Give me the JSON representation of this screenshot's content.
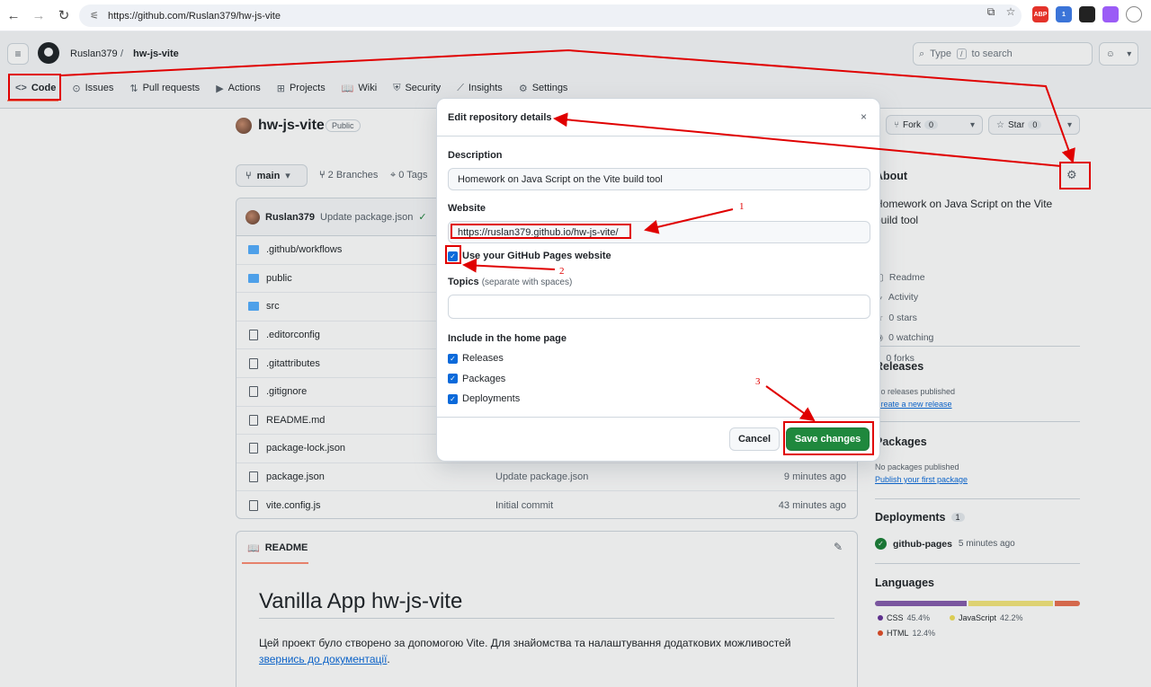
{
  "browser": {
    "url": "https://github.com/Ruslan379/hw-js-vite",
    "back_icon": "←",
    "forward_icon": "→",
    "reload_icon": "↻",
    "extensions": [
      {
        "label": "ABP",
        "color": "#e4332a"
      },
      {
        "label": "1",
        "color": "#3b74d8"
      },
      {
        "label": "",
        "color": "#222222"
      },
      {
        "label": "",
        "color": "#9b5cf6"
      },
      {
        "label": "",
        "color": "#888888"
      }
    ]
  },
  "header": {
    "owner": "Ruslan379",
    "separator": "/",
    "repo": "hw-js-vite",
    "search_placeholder": "Type",
    "search_key": "/",
    "search_suffix": "to search"
  },
  "tabs": [
    {
      "label": "Code",
      "icon": "<>"
    },
    {
      "label": "Issues",
      "icon": "⊙"
    },
    {
      "label": "Pull requests",
      "icon": "⇅"
    },
    {
      "label": "Actions",
      "icon": "▶"
    },
    {
      "label": "Projects",
      "icon": "⊞"
    },
    {
      "label": "Wiki",
      "icon": "📖"
    },
    {
      "label": "Security",
      "icon": "⛨"
    },
    {
      "label": "Insights",
      "icon": "⟋"
    },
    {
      "label": "Settings",
      "icon": "⚙"
    }
  ],
  "repo": {
    "name": "hw-js-vite",
    "visibility": "Public",
    "branch": "main",
    "branches": "2 Branches",
    "tags": "0 Tags",
    "commit_author": "Ruslan379",
    "commit_message": "Update package.json"
  },
  "files": [
    {
      "name": ".github/workflows",
      "type": "folder",
      "message": "",
      "time": ""
    },
    {
      "name": "public",
      "type": "folder",
      "message": "",
      "time": ""
    },
    {
      "name": "src",
      "type": "folder",
      "message": "",
      "time": ""
    },
    {
      "name": ".editorconfig",
      "type": "file",
      "message": "",
      "time": ""
    },
    {
      "name": ".gitattributes",
      "type": "file",
      "message": "",
      "time": ""
    },
    {
      "name": ".gitignore",
      "type": "file",
      "message": "",
      "time": ""
    },
    {
      "name": "README.md",
      "type": "file",
      "message": "",
      "time": ""
    },
    {
      "name": "package-lock.json",
      "type": "file",
      "message": "",
      "time": ""
    },
    {
      "name": "package.json",
      "type": "file",
      "message": "Update package.json",
      "time": "9 minutes ago"
    },
    {
      "name": "vite.config.js",
      "type": "file",
      "message": "Initial commit",
      "time": "43 minutes ago"
    }
  ],
  "readme": {
    "tab_label": "README",
    "title": "Vanilla App hw-js-vite",
    "text": "Цей проект було створено за допомогою Vite. Для знайомства та налаштування додаткових можливостей",
    "link": "звернись до документації",
    "link_suffix": "."
  },
  "top_actions": {
    "fork_label": "Fork",
    "fork_count": "0",
    "star_label": "Star",
    "star_count": "0"
  },
  "sidebar": {
    "about_title": "About",
    "description": "Homework on Java Script on the Vite build tool",
    "items": [
      "Readme",
      "Activity",
      "0 stars",
      "0 watching",
      "0 forks"
    ],
    "releases_title": "Releases",
    "releases_text": "No releases published",
    "releases_link": "Create a new release",
    "packages_title": "Packages",
    "packages_text": "No packages published",
    "packages_link": "Publish your first package",
    "deployments_title": "Deployments",
    "deployments_count": "1",
    "deployment_name": "github-pages",
    "deployment_time": "5 minutes ago",
    "languages_title": "Languages",
    "languages": [
      {
        "name": "CSS",
        "pct": "45.4%",
        "value": 45.4,
        "color": "#663399"
      },
      {
        "name": "JavaScript",
        "pct": "42.2%",
        "value": 42.2,
        "color": "#f1e05a"
      },
      {
        "name": "HTML",
        "pct": "12.4%",
        "value": 12.4,
        "color": "#e34c26"
      }
    ]
  },
  "dialog": {
    "title": "Edit repository details",
    "close": "×",
    "description_label": "Description",
    "description_value": "Homework on Java Script on the Vite build tool",
    "website_label": "Website",
    "website_value": "https://ruslan379.github.io/hw-js-vite/",
    "use_pages_label": "Use your GitHub Pages website",
    "topics_label": "Topics",
    "topics_hint": "(separate with spaces)",
    "include_label": "Include in the home page",
    "include_options": [
      "Releases",
      "Packages",
      "Deployments"
    ],
    "cancel_label": "Cancel",
    "save_label": "Save changes"
  },
  "annotations": {
    "step1": "1",
    "step2": "2",
    "step3": "3"
  }
}
